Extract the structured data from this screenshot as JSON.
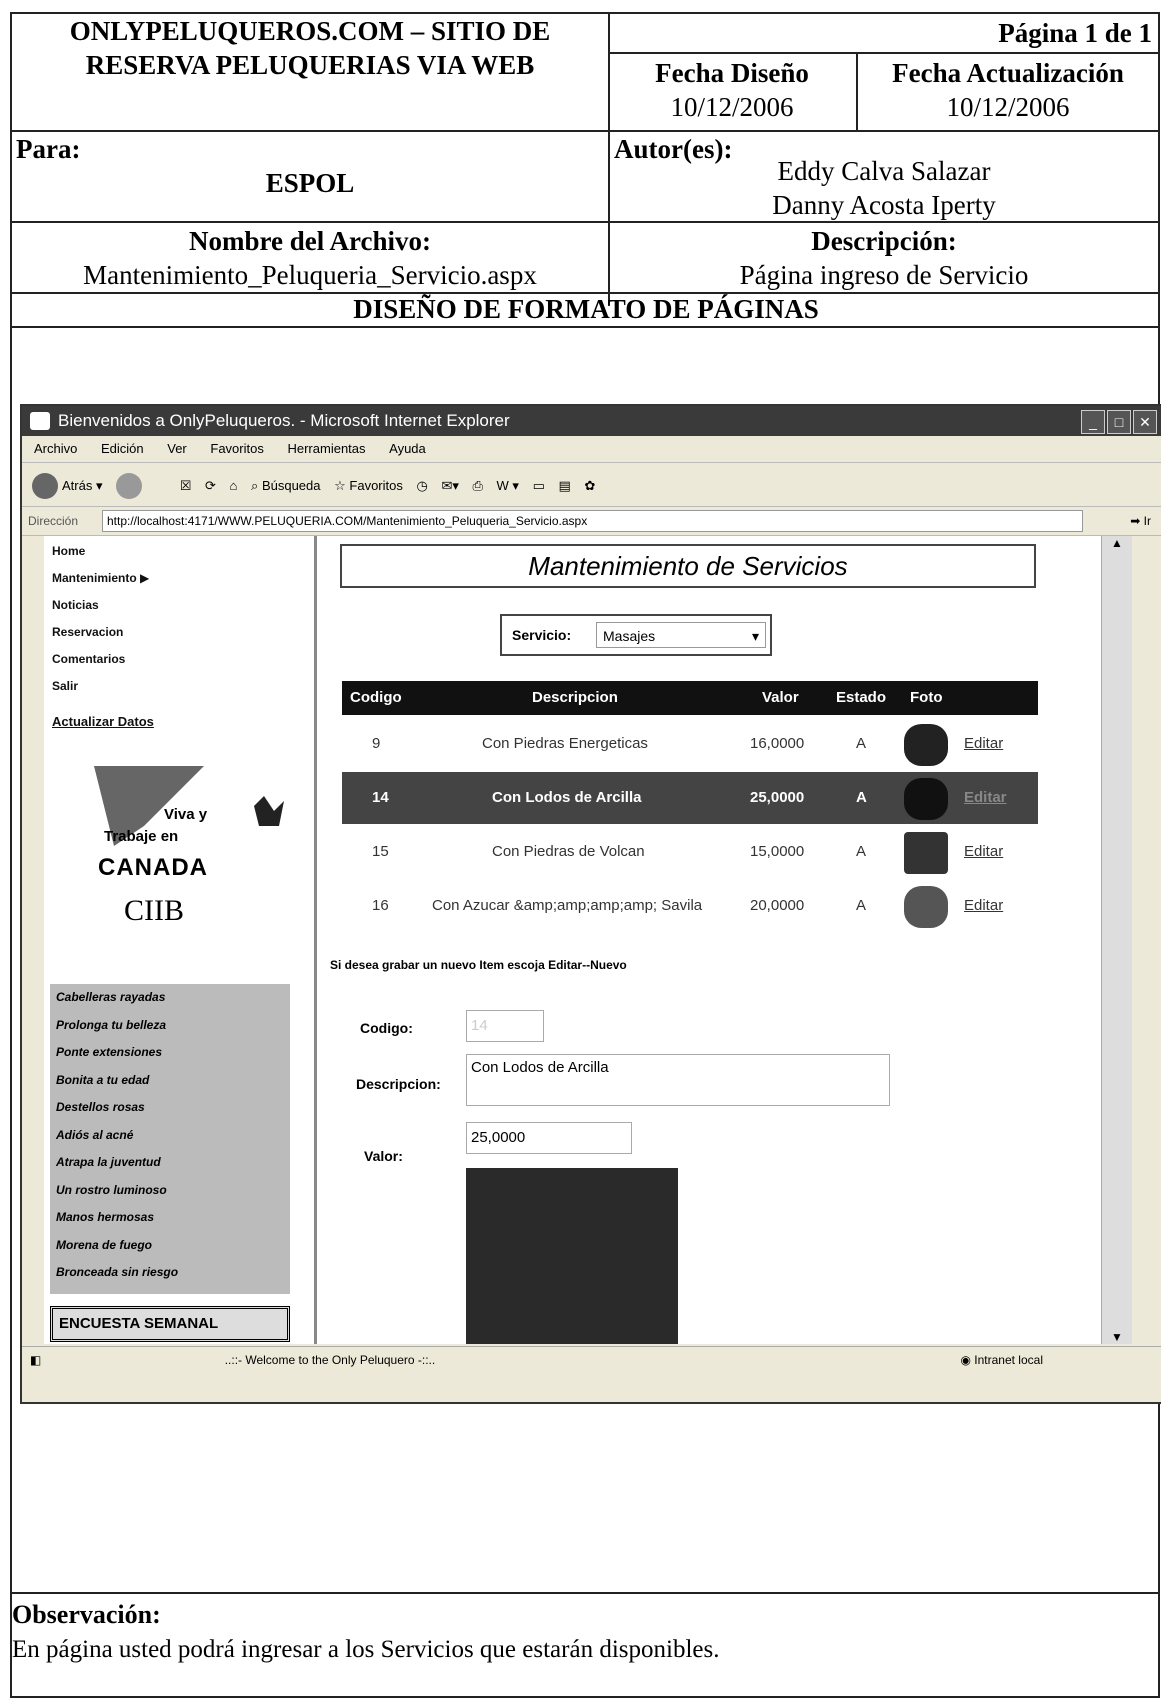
{
  "header": {
    "title_line1": "ONLYPELUQUEROS.COM – SITIO DE",
    "title_line2": "RESERVA PELUQUERIAS VIA WEB",
    "page": "Página 1 de 1",
    "fecha_diseno_label": "Fecha Diseño",
    "fecha_diseno": "10/12/2006",
    "fecha_act_label": "Fecha Actualización",
    "fecha_act": "10/12/2006",
    "para_label": "Para:",
    "para": "ESPOL",
    "autor_label": "Autor(es):",
    "autor1": "Eddy Calva Salazar",
    "autor2": "Danny Acosta Iperty",
    "archivo_label": "Nombre del Archivo:",
    "archivo": "Mantenimiento_Peluqueria_Servicio.aspx",
    "desc_label": "Descripción:",
    "desc": "Página  ingreso de Servicio",
    "section": "DISEÑO DE FORMATO DE PÁGINAS"
  },
  "browser": {
    "title": "Bienvenidos a OnlyPeluqueros. - Microsoft Internet Explorer",
    "menu": [
      "Archivo",
      "Edición",
      "Ver",
      "Favoritos",
      "Herramientas",
      "Ayuda"
    ],
    "back": "Atrás",
    "search": "Búsqueda",
    "favorites": "Favoritos",
    "address_label": "Dirección",
    "url": "http://localhost:4171/WWW.PELUQUERIA.COM/Mantenimiento_Peluqueria_Servicio.aspx",
    "go": "Ir",
    "status": "..::- Welcome to the Only Peluquero -::..",
    "zone": "Intranet local"
  },
  "nav": {
    "items": [
      "Home",
      "Mantenimiento",
      "Noticias",
      "Reservacion",
      "Comentarios",
      "Salir"
    ],
    "update": "Actualizar Datos",
    "ad_line1": "Viva y",
    "ad_line2": "Trabaje en",
    "ad_line3": "CANADA",
    "ad_logo": "CIIB",
    "links": [
      "Cabelleras rayadas",
      "Prolonga tu belleza",
      "Ponte extensiones",
      "Bonita a tu edad",
      "Destellos rosas",
      "Adiós al acné",
      "Atrapa la juventud",
      "Un rostro luminoso",
      "Manos hermosas",
      "Morena de fuego",
      "Bronceada sin riesgo"
    ],
    "survey": "ENCUESTA SEMANAL"
  },
  "main": {
    "title": "Mantenimiento de Servicios",
    "service_label": "Servicio:",
    "service_value": "Masajes",
    "headers": [
      "Codigo",
      "Descripcion",
      "Valor",
      "Estado",
      "Foto"
    ],
    "rows": [
      {
        "codigo": "9",
        "desc": "Con Piedras Energeticas",
        "valor": "16,0000",
        "estado": "A",
        "edit": "Editar"
      },
      {
        "codigo": "14",
        "desc": "Con Lodos de Arcilla",
        "valor": "25,0000",
        "estado": "A",
        "edit": "Editar"
      },
      {
        "codigo": "15",
        "desc": "Con Piedras de Volcan",
        "valor": "15,0000",
        "estado": "A",
        "edit": "Editar"
      },
      {
        "codigo": "16",
        "desc": "Con Azucar &amp;amp;amp;amp; Savila",
        "valor": "20,0000",
        "estado": "A",
        "edit": "Editar"
      }
    ],
    "note": "Si desea grabar un nuevo Item escoja Editar--Nuevo",
    "codigo_label": "Codigo:",
    "codigo_value": "14",
    "desc_label": "Descripcion:",
    "desc_value": "Con Lodos de Arcilla",
    "valor_label": "Valor:",
    "valor_value": "25,0000"
  },
  "observacion": {
    "label": "Observación:",
    "text": "En página usted podrá ingresar a los Servicios que estarán disponibles."
  }
}
